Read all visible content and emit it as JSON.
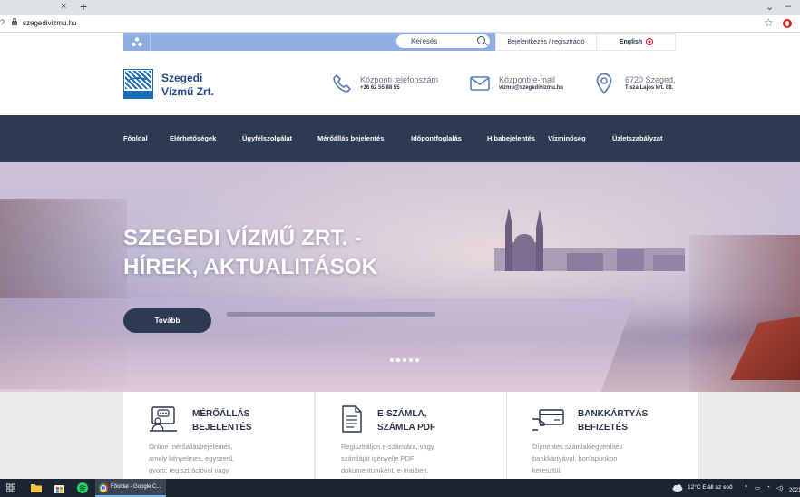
{
  "browser": {
    "tab_close": "×",
    "new_tab": "+",
    "url": "szegedivizmu.hu",
    "win_collapse": "⌄",
    "win_min": "–"
  },
  "topbar": {
    "search_placeholder": "Keresés",
    "login_label": "Bejelentkezés / regisztráció",
    "language_label": "English"
  },
  "header": {
    "logo_line1": "Szegedi",
    "logo_line2": "Vízmű Zrt.",
    "phone_label": "Központi telefonszám",
    "phone_value": "+36 62 55 88 55",
    "email_label": "Központi e-mail",
    "email_value": "vizmu@szegedivizmu.hu",
    "address_label": "6720 Szeged,",
    "address_value": "Tisza Lajos krt. 88."
  },
  "nav": {
    "items": [
      "Főoldal",
      "Elérhetőségek",
      "Ügyfélszolgálat",
      "Mérőállás bejelentés",
      "Időpontfoglalás",
      "Hibabejelentés",
      "Vízminőség",
      "Üzletszabályzat"
    ]
  },
  "hero": {
    "title_line1": "SZEGEDI VÍZMŰ ZRT. -",
    "title_line2": "HÍREK, AKTUALITÁSOK",
    "button_label": "Tovább",
    "slide_count": 5
  },
  "features": [
    {
      "title_line1": "MÉRŐÁLLÁS",
      "title_line2": "BEJELENTÉS",
      "desc_lines": [
        "Online mérőállásbejelentés,",
        "amely kényelmes, egyszerű,",
        "gyors; regisztrációval vagy"
      ]
    },
    {
      "title_line1": "E-SZÁMLA,",
      "title_line2": "SZÁMLA PDF",
      "desc_lines": [
        "Regisztráljon e-számlára, vagy",
        "számláját igényelje PDF",
        "dokumentumként, e-mailben."
      ]
    },
    {
      "title_line1": "BANKKÁRTYÁS",
      "title_line2": "BEFIZETÉS",
      "desc_lines": [
        "Díjmentes számlakiegyenlítés",
        "bankkártyával, honlapunkon",
        "keresztül."
      ]
    }
  ],
  "taskbar": {
    "chrome_tab_label": "Főoldal - Google C...",
    "weather": "12°C  Eláll az eső",
    "clock_year": "2021"
  },
  "colors": {
    "navy": "#2e3a52",
    "topbar_blue": "#8faddf",
    "brand_blue": "#1f4b8e",
    "card_text": "#8a8f99"
  }
}
